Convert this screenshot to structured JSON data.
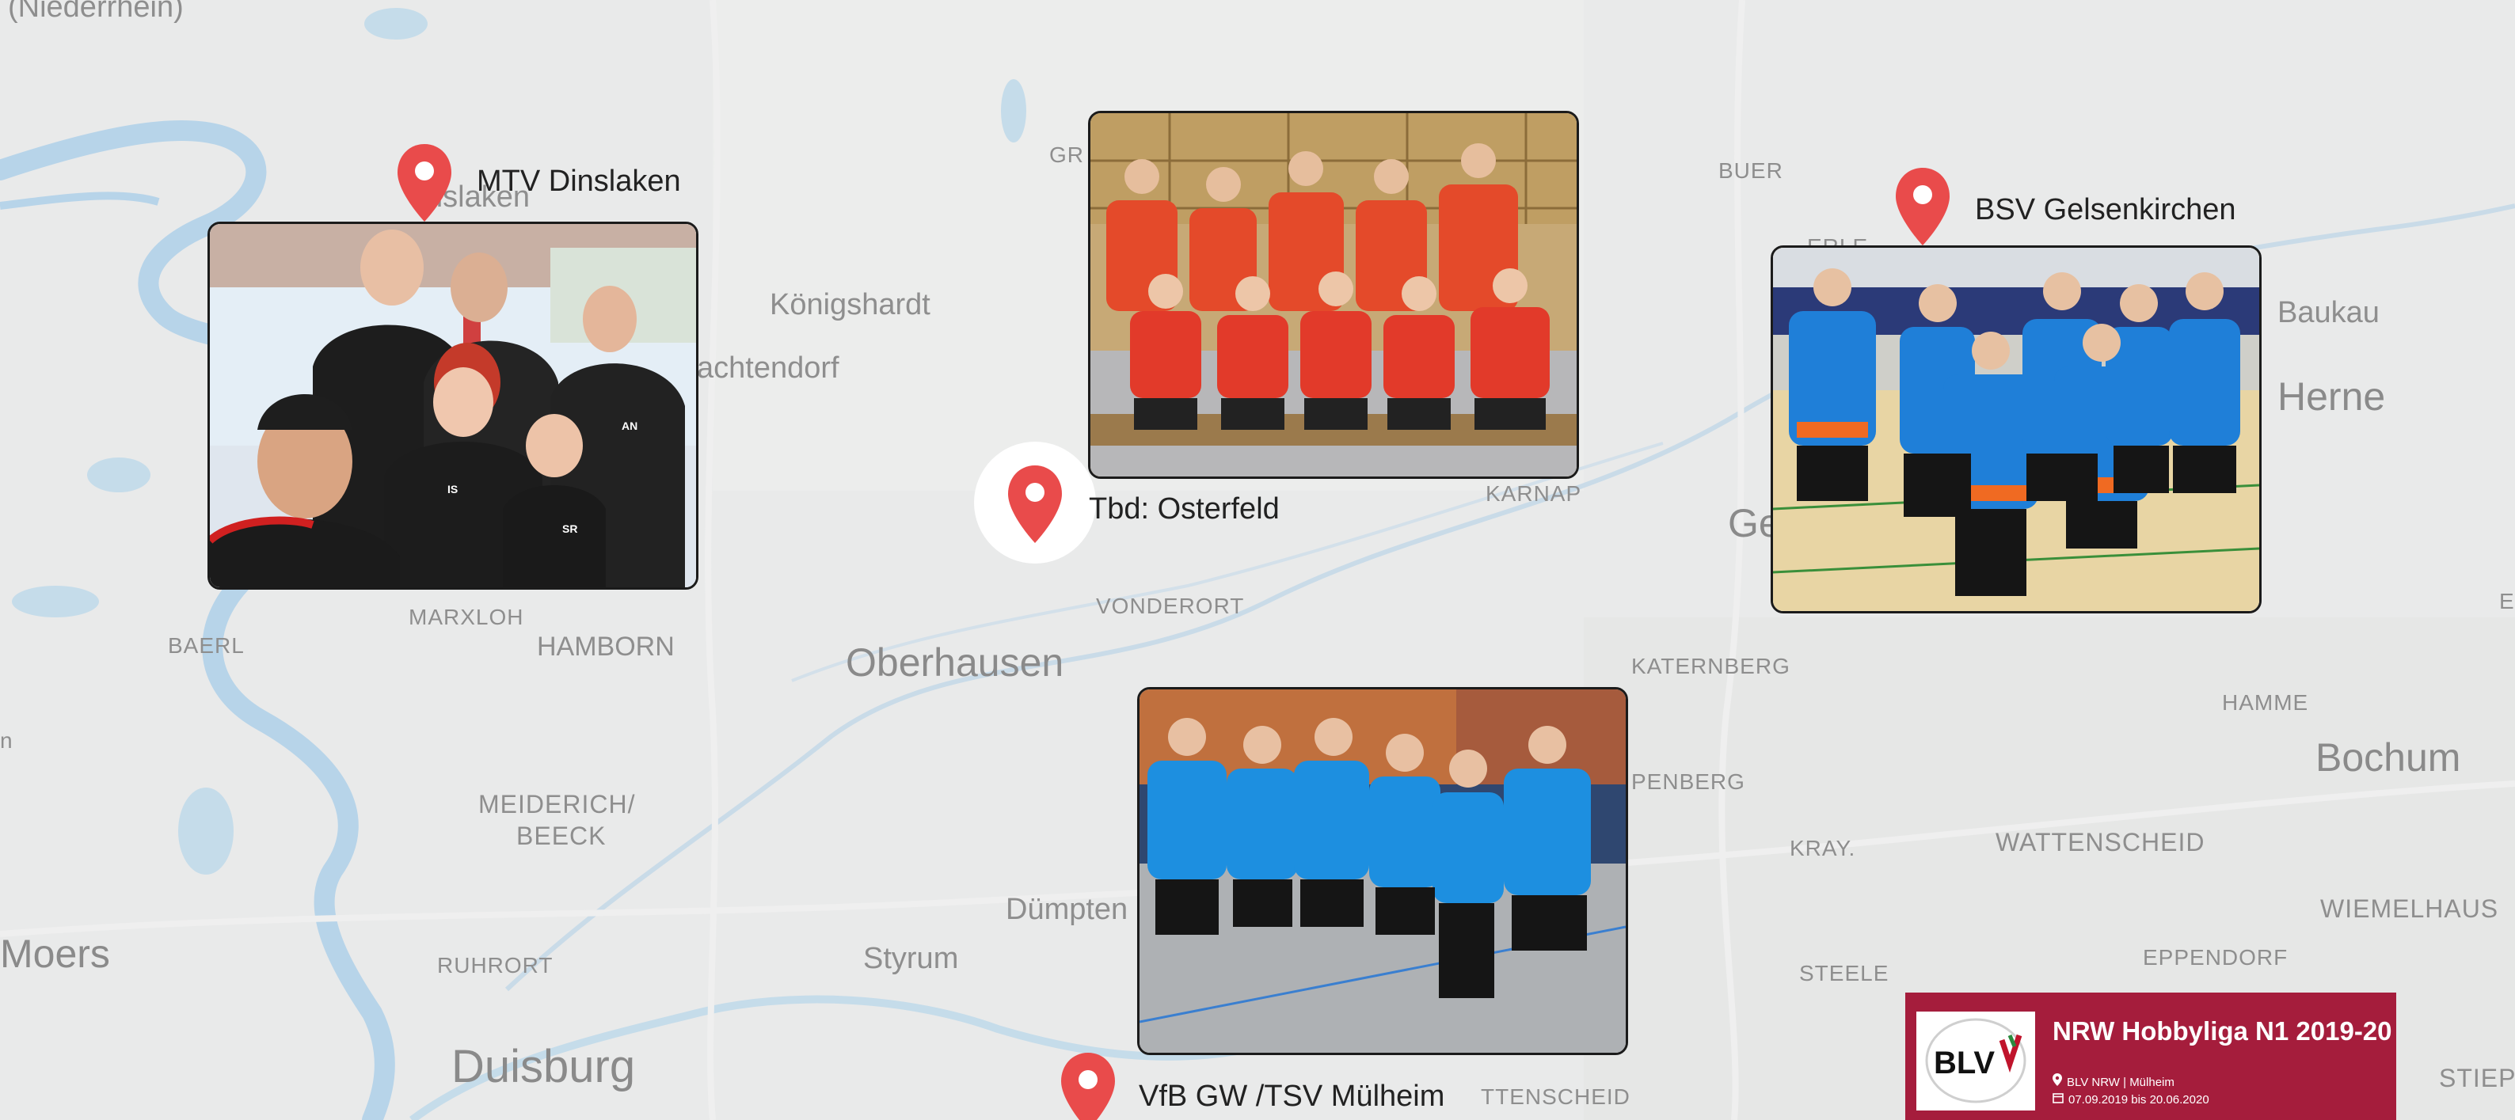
{
  "map": {
    "places": [
      {
        "id": "niederrhein",
        "text": "(Niederrhein)"
      },
      {
        "id": "dinslaken-ghost",
        "text": "nslaken"
      },
      {
        "id": "koenigshardt",
        "text": "Königshardt"
      },
      {
        "id": "sachtendorf",
        "text": "achtendorf"
      },
      {
        "id": "gr",
        "text": "GR"
      },
      {
        "id": "buer",
        "text": "BUER"
      },
      {
        "id": "baukau",
        "text": "Baukau"
      },
      {
        "id": "herne",
        "text": "Herne"
      },
      {
        "id": "karnap",
        "text": "KARNAP"
      },
      {
        "id": "ge",
        "text": "Ge"
      },
      {
        "id": "baerl",
        "text": "BAERL"
      },
      {
        "id": "marxloh",
        "text": "MARXLOH"
      },
      {
        "id": "hamborn",
        "text": "HAMBORN"
      },
      {
        "id": "vonderort",
        "text": "VONDERORT"
      },
      {
        "id": "oberhausen",
        "text": "Oberhausen"
      },
      {
        "id": "katernberg",
        "text": "KATERNBERG"
      },
      {
        "id": "hamme",
        "text": "HAMME"
      },
      {
        "id": "bochum",
        "text": "Bochum"
      },
      {
        "id": "meiderich",
        "text": "MEIDERICH/"
      },
      {
        "id": "beeck",
        "text": "BEECK"
      },
      {
        "id": "penberg",
        "text": "PENBERG"
      },
      {
        "id": "kray",
        "text": "KRAY."
      },
      {
        "id": "wattenscheid",
        "text": "WATTENSCHEID"
      },
      {
        "id": "moers",
        "text": "Moers"
      },
      {
        "id": "duempten",
        "text": "Dümpten"
      },
      {
        "id": "styrum",
        "text": "Styrum"
      },
      {
        "id": "wiemelhaus",
        "text": "WIEMELHAUS"
      },
      {
        "id": "ruhrort",
        "text": "RUHRORT"
      },
      {
        "id": "steele",
        "text": "STEELE"
      },
      {
        "id": "eppendorf",
        "text": "EPPENDORF"
      },
      {
        "id": "duisburg",
        "text": "Duisburg"
      },
      {
        "id": "attenscheid",
        "text": "TTENSCHEID"
      },
      {
        "id": "stiepe",
        "text": "STIEPE"
      },
      {
        "id": "erle",
        "text": "ERLE"
      },
      {
        "id": "n-edge",
        "text": "n"
      },
      {
        "id": "e-edge",
        "text": "E"
      }
    ],
    "markers": [
      {
        "id": "mtv",
        "label": "MTV Dinslaken"
      },
      {
        "id": "bsv",
        "label": "BSV Gelsenkirchen"
      },
      {
        "id": "tbd",
        "label": "Tbd: Osterfeld"
      },
      {
        "id": "vfb",
        "label": "VfB GW /TSV Mülheim"
      }
    ],
    "colors": {
      "background": "#e9eaea",
      "water": "#b7d4e9",
      "pin": "#e94b4b",
      "card": "#a51d3c"
    },
    "icons": [
      "map-pin-icon",
      "location-icon",
      "calendar-icon"
    ]
  },
  "photos": {
    "mtv_jerseys": [
      "IS",
      "AN",
      "SR"
    ]
  },
  "event": {
    "title": "NRW Hobbyliga N1 2019-20",
    "logo_text": "BLV",
    "location": "BLV NRW | Mülheim",
    "dates": "07.09.2019 bis 20.06.2020"
  }
}
